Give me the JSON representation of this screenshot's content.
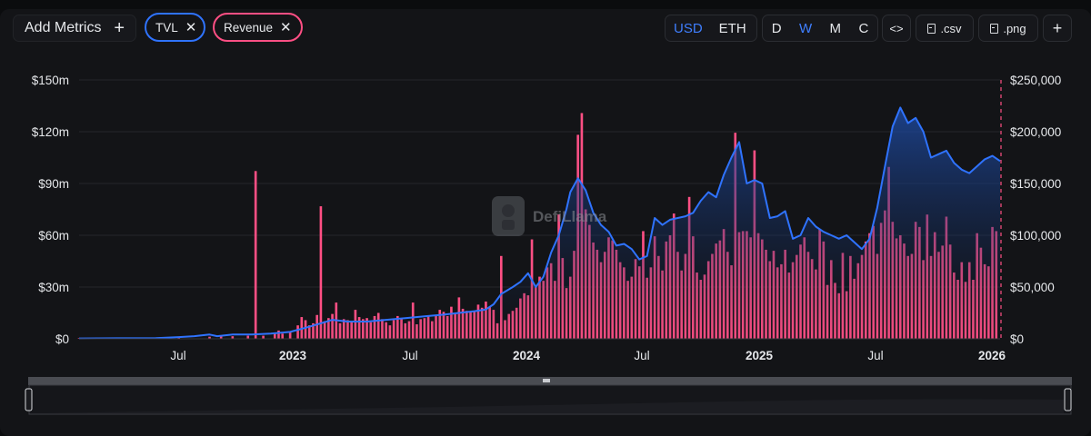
{
  "toolbar": {
    "add_metrics_label": "Add Metrics",
    "add_icon": "plus-icon",
    "chips": [
      {
        "label": "TVL",
        "color": "#2f73ff"
      },
      {
        "label": "Revenue",
        "color": "#ff4f84"
      }
    ],
    "currency_options": [
      "USD",
      "ETH"
    ],
    "currency_selected": "USD",
    "period_options": [
      "D",
      "W",
      "M",
      "C"
    ],
    "period_selected": "W",
    "code_icon": "code-icon",
    "csv_label": ".csv",
    "png_label": ".png",
    "more_icon": "plus-icon"
  },
  "watermark": "DefiLlama",
  "chart_data": {
    "type": "bar+line",
    "x_tick_labels": [
      {
        "label": "Jul",
        "bold": false
      },
      {
        "label": "2023",
        "bold": true
      },
      {
        "label": "Jul",
        "bold": false
      },
      {
        "label": "2024",
        "bold": true
      },
      {
        "label": "Jul",
        "bold": false
      },
      {
        "label": "2025",
        "bold": true
      },
      {
        "label": "Jul",
        "bold": false
      },
      {
        "label": "2026",
        "bold": true
      }
    ],
    "y_left": {
      "label": "TVL",
      "ticks": [
        "$0",
        "$30m",
        "$60m",
        "$90m",
        "$120m",
        "$150m"
      ],
      "range": [
        0,
        150
      ],
      "unit": "m"
    },
    "y_right": {
      "label": "Revenue",
      "ticks": [
        "$0",
        "$50,000",
        "$100,000",
        "$150,000",
        "$200,000",
        "$250,000"
      ],
      "range": [
        0,
        250000
      ]
    },
    "x_range_weeks": [
      0,
      191
    ],
    "tick_weeks": [
      20,
      45,
      71,
      97,
      122,
      148,
      174,
      200
    ],
    "series": [
      {
        "name": "TVL",
        "kind": "area-line",
        "color": "#2f73ff",
        "unit": "USD millions",
        "points": [
          [
            0,
            0.2
          ],
          [
            20,
            0.4
          ],
          [
            26,
            1
          ],
          [
            30,
            1.5
          ],
          [
            34,
            2.5
          ],
          [
            36,
            1.5
          ],
          [
            40,
            2.5
          ],
          [
            45,
            2.5
          ],
          [
            50,
            3
          ],
          [
            55,
            4
          ],
          [
            60,
            7
          ],
          [
            63,
            9
          ],
          [
            66,
            11
          ],
          [
            70,
            10
          ],
          [
            75,
            10
          ],
          [
            80,
            11
          ],
          [
            85,
            12
          ],
          [
            90,
            13
          ],
          [
            95,
            14
          ],
          [
            99,
            15
          ],
          [
            103,
            16
          ],
          [
            106,
            17
          ],
          [
            108,
            20
          ],
          [
            110,
            26
          ],
          [
            113,
            30
          ],
          [
            115,
            33
          ],
          [
            117,
            38
          ],
          [
            119,
            30
          ],
          [
            121,
            36
          ],
          [
            123,
            50
          ],
          [
            125,
            60
          ],
          [
            127,
            75
          ],
          [
            128,
            85
          ],
          [
            130,
            93
          ],
          [
            132,
            86
          ],
          [
            134,
            73
          ],
          [
            136,
            66
          ],
          [
            138,
            62
          ],
          [
            140,
            54
          ],
          [
            142,
            55
          ],
          [
            144,
            52
          ],
          [
            146,
            46
          ],
          [
            148,
            48
          ],
          [
            150,
            70
          ],
          [
            152,
            66
          ],
          [
            154,
            69
          ],
          [
            156,
            70
          ],
          [
            158,
            71
          ],
          [
            160,
            73
          ],
          [
            162,
            80
          ],
          [
            164,
            85
          ],
          [
            166,
            82
          ],
          [
            168,
            95
          ],
          [
            170,
            105
          ],
          [
            172,
            114
          ],
          [
            174,
            90
          ],
          [
            176,
            92
          ],
          [
            178,
            90
          ],
          [
            180,
            70
          ],
          [
            182,
            71
          ],
          [
            184,
            74
          ],
          [
            186,
            58
          ],
          [
            188,
            60
          ],
          [
            190,
            70
          ],
          [
            192,
            65
          ],
          [
            194,
            62
          ],
          [
            196,
            60
          ],
          [
            198,
            58
          ],
          [
            200,
            60
          ],
          [
            202,
            56
          ],
          [
            204,
            52
          ],
          [
            206,
            58
          ],
          [
            208,
            76
          ],
          [
            210,
            100
          ],
          [
            212,
            123
          ],
          [
            214,
            134
          ],
          [
            216,
            125
          ],
          [
            218,
            128
          ],
          [
            220,
            120
          ],
          [
            222,
            105
          ],
          [
            224,
            107
          ],
          [
            226,
            109
          ],
          [
            228,
            102
          ],
          [
            230,
            98
          ],
          [
            232,
            96
          ],
          [
            234,
            100
          ],
          [
            236,
            104
          ],
          [
            238,
            106
          ],
          [
            240,
            103
          ]
        ]
      },
      {
        "name": "Revenue",
        "kind": "bar",
        "color": "#ff4f84",
        "unit": "USD",
        "values": [
          [
            0,
            500
          ],
          [
            10,
            1000
          ],
          [
            20,
            1000
          ],
          [
            26,
            1500
          ],
          [
            34,
            2000
          ],
          [
            37,
            3000
          ],
          [
            40,
            2500
          ],
          [
            44,
            3000
          ],
          [
            46,
            162000
          ],
          [
            48,
            3000
          ],
          [
            51,
            5000
          ],
          [
            52,
            8000
          ],
          [
            53,
            5000
          ],
          [
            55,
            7000
          ],
          [
            57,
            13000
          ],
          [
            58,
            21000
          ],
          [
            59,
            18000
          ],
          [
            60,
            13000
          ],
          [
            61,
            15000
          ],
          [
            62,
            23000
          ],
          [
            63,
            128000
          ],
          [
            64,
            17000
          ],
          [
            65,
            20000
          ],
          [
            66,
            24000
          ],
          [
            67,
            35000
          ],
          [
            68,
            15000
          ],
          [
            69,
            19000
          ],
          [
            70,
            18000
          ],
          [
            71,
            16000
          ],
          [
            72,
            28000
          ],
          [
            73,
            21000
          ],
          [
            74,
            19000
          ],
          [
            75,
            20000
          ],
          [
            76,
            16000
          ],
          [
            77,
            22000
          ],
          [
            78,
            25000
          ],
          [
            79,
            19000
          ],
          [
            80,
            16000
          ],
          [
            81,
            13000
          ],
          [
            82,
            18000
          ],
          [
            83,
            22000
          ],
          [
            84,
            19000
          ],
          [
            85,
            15000
          ],
          [
            86,
            17000
          ],
          [
            87,
            35000
          ],
          [
            88,
            14000
          ],
          [
            89,
            19000
          ],
          [
            90,
            20000
          ],
          [
            91,
            22000
          ],
          [
            92,
            17000
          ],
          [
            93,
            22000
          ],
          [
            94,
            28000
          ],
          [
            95,
            26000
          ],
          [
            96,
            22000
          ],
          [
            97,
            31000
          ],
          [
            98,
            25000
          ],
          [
            99,
            40000
          ],
          [
            100,
            29000
          ],
          [
            101,
            27000
          ],
          [
            102,
            26000
          ],
          [
            103,
            27000
          ],
          [
            104,
            33000
          ],
          [
            105,
            30000
          ],
          [
            106,
            36000
          ],
          [
            107,
            31000
          ],
          [
            108,
            28000
          ],
          [
            109,
            15000
          ],
          [
            110,
            80000
          ],
          [
            111,
            18000
          ],
          [
            112,
            24000
          ],
          [
            113,
            27000
          ],
          [
            114,
            30000
          ],
          [
            115,
            39000
          ],
          [
            116,
            44000
          ],
          [
            117,
            42000
          ],
          [
            118,
            96000
          ],
          [
            119,
            50000
          ],
          [
            120,
            60000
          ],
          [
            121,
            56000
          ],
          [
            122,
            69000
          ],
          [
            123,
            73000
          ],
          [
            124,
            56000
          ],
          [
            125,
            120000
          ],
          [
            126,
            78000
          ],
          [
            127,
            49000
          ],
          [
            128,
            60000
          ],
          [
            129,
            85000
          ],
          [
            130,
            197000
          ],
          [
            131,
            218000
          ],
          [
            132,
            125000
          ],
          [
            133,
            110000
          ],
          [
            134,
            93000
          ],
          [
            135,
            86000
          ],
          [
            136,
            74000
          ],
          [
            137,
            84000
          ],
          [
            138,
            98000
          ],
          [
            139,
            95000
          ],
          [
            140,
            86000
          ],
          [
            141,
            74000
          ],
          [
            142,
            69000
          ],
          [
            143,
            56000
          ],
          [
            144,
            60000
          ],
          [
            145,
            77000
          ],
          [
            146,
            70000
          ],
          [
            147,
            104000
          ],
          [
            148,
            59000
          ],
          [
            149,
            69000
          ],
          [
            150,
            99000
          ],
          [
            151,
            80000
          ],
          [
            152,
            66000
          ],
          [
            153,
            94000
          ],
          [
            154,
            100000
          ],
          [
            155,
            121000
          ],
          [
            156,
            84000
          ],
          [
            157,
            66000
          ],
          [
            158,
            82000
          ],
          [
            159,
            137000
          ],
          [
            160,
            99000
          ],
          [
            161,
            64000
          ],
          [
            162,
            57000
          ],
          [
            163,
            62000
          ],
          [
            164,
            75000
          ],
          [
            165,
            82000
          ],
          [
            166,
            92000
          ],
          [
            167,
            95000
          ],
          [
            168,
            106000
          ],
          [
            169,
            84000
          ],
          [
            170,
            71000
          ],
          [
            171,
            199000
          ],
          [
            172,
            103000
          ],
          [
            173,
            104000
          ],
          [
            174,
            104000
          ],
          [
            175,
            98000
          ],
          [
            176,
            182000
          ],
          [
            177,
            102000
          ],
          [
            178,
            96000
          ],
          [
            179,
            86000
          ],
          [
            180,
            75000
          ],
          [
            181,
            85000
          ],
          [
            182,
            69000
          ],
          [
            183,
            72000
          ],
          [
            184,
            86000
          ],
          [
            185,
            64000
          ],
          [
            186,
            74000
          ],
          [
            187,
            81000
          ],
          [
            188,
            91000
          ],
          [
            189,
            98000
          ],
          [
            190,
            84000
          ],
          [
            191,
            77000
          ],
          [
            192,
            67000
          ],
          [
            193,
            106000
          ],
          [
            194,
            94000
          ],
          [
            195,
            52000
          ],
          [
            196,
            76000
          ],
          [
            197,
            54000
          ],
          [
            198,
            44000
          ],
          [
            199,
            83000
          ],
          [
            200,
            46000
          ],
          [
            201,
            80000
          ],
          [
            202,
            58000
          ],
          [
            203,
            73000
          ],
          [
            204,
            81000
          ],
          [
            205,
            94000
          ],
          [
            206,
            102000
          ],
          [
            207,
            109000
          ],
          [
            208,
            82000
          ],
          [
            209,
            112000
          ],
          [
            210,
            124000
          ],
          [
            211,
            166000
          ],
          [
            212,
            113000
          ],
          [
            213,
            97000
          ],
          [
            214,
            100000
          ],
          [
            215,
            92000
          ],
          [
            216,
            80000
          ],
          [
            217,
            82000
          ],
          [
            218,
            113000
          ],
          [
            219,
            108000
          ],
          [
            220,
            76000
          ],
          [
            221,
            120000
          ],
          [
            222,
            80000
          ],
          [
            223,
            103000
          ],
          [
            224,
            84000
          ],
          [
            225,
            90000
          ],
          [
            226,
            118000
          ],
          [
            227,
            91000
          ],
          [
            228,
            64000
          ],
          [
            229,
            57000
          ],
          [
            230,
            74000
          ],
          [
            231,
            55000
          ],
          [
            232,
            74000
          ],
          [
            233,
            57000
          ],
          [
            234,
            102000
          ],
          [
            235,
            88000
          ],
          [
            236,
            72000
          ],
          [
            237,
            70000
          ],
          [
            238,
            108000
          ],
          [
            239,
            104000
          ]
        ]
      }
    ],
    "grid": true,
    "legend": "top-left chips",
    "brush_range": "full"
  }
}
